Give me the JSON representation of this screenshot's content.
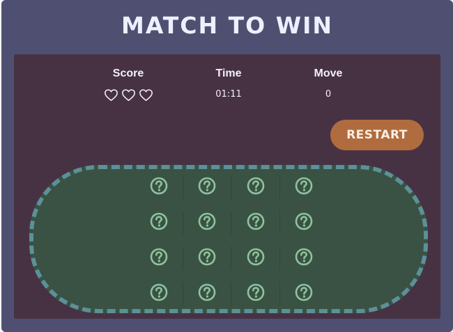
{
  "title": "MATCH TO WIN",
  "stats": {
    "score_label": "Score",
    "time_label": "Time",
    "time_value": "01:11",
    "move_label": "Move",
    "move_value": "0",
    "hearts": 3
  },
  "restart_label": "RESTART",
  "board": {
    "rows": 4,
    "cols": 4,
    "cards": [
      "?",
      "?",
      "?",
      "?",
      "?",
      "?",
      "?",
      "?",
      "?",
      "?",
      "?",
      "?",
      "?",
      "?",
      "?",
      "?"
    ],
    "card_icon": "question-circle-icon"
  },
  "colors": {
    "frame": "#4f5071",
    "panel": "#473244",
    "table": "#3a5244",
    "table_border": "#5b9197",
    "card_icon": "#8fc39d",
    "restart": "#b06c3e"
  }
}
